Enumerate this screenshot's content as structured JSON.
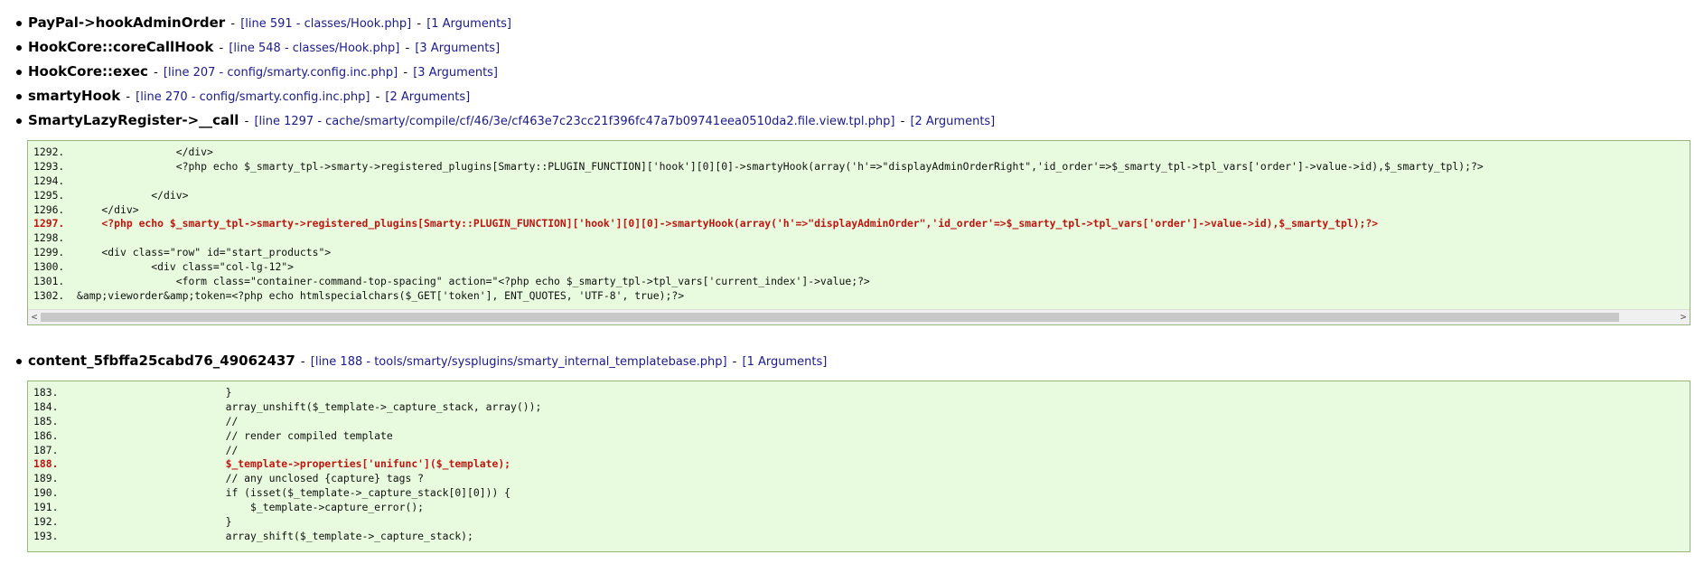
{
  "frames": [
    {
      "fn": "PayPal->hookAdminOrder",
      "location": "[line 591 - classes/Hook.php]",
      "args": "[1 Arguments]"
    },
    {
      "fn": "HookCore::coreCallHook",
      "location": "[line 548 - classes/Hook.php]",
      "args": "[3 Arguments]"
    },
    {
      "fn": "HookCore::exec",
      "location": "[line 207 - config/smarty.config.inc.php]",
      "args": "[3 Arguments]"
    },
    {
      "fn": "smartyHook",
      "location": "[line 270 - config/smarty.config.inc.php]",
      "args": "[2 Arguments]"
    },
    {
      "fn": "SmartyLazyRegister->__call",
      "location": "[line 1297 - cache/smarty/compile/cf/46/3e/cf463e7c23cc21f396fc47a7b09741eea0510da2.file.view.tpl.php]",
      "args": "[2 Arguments]"
    },
    {
      "fn": "content_5fbffa25cabd76_49062437",
      "location": "[line 188 - tools/smarty/sysplugins/smarty_internal_templatebase.php]",
      "args": "[1 Arguments]"
    }
  ],
  "separator": "-",
  "code_block_1": {
    "lines": [
      {
        "num": "1292.",
        "text": "                </div>",
        "highlight": false
      },
      {
        "num": "1293.",
        "text": "                <?php echo $_smarty_tpl->smarty->registered_plugins[Smarty::PLUGIN_FUNCTION]['hook'][0][0]->smartyHook(array('h'=>\"displayAdminOrderRight\",'id_order'=>$_smarty_tpl->tpl_vars['order']->value->id),$_smarty_tpl);?>",
        "highlight": false
      },
      {
        "num": "1294.",
        "text": "",
        "highlight": false
      },
      {
        "num": "1295.",
        "text": "            </div>",
        "highlight": false
      },
      {
        "num": "1296.",
        "text": "    </div>",
        "highlight": false
      },
      {
        "num": "1297.",
        "text": "    <?php echo $_smarty_tpl->smarty->registered_plugins[Smarty::PLUGIN_FUNCTION]['hook'][0][0]->smartyHook(array('h'=>\"displayAdminOrder\",'id_order'=>$_smarty_tpl->tpl_vars['order']->value->id),$_smarty_tpl);?>",
        "highlight": true
      },
      {
        "num": "1298.",
        "text": "",
        "highlight": false
      },
      {
        "num": "1299.",
        "text": "    <div class=\"row\" id=\"start_products\">",
        "highlight": false
      },
      {
        "num": "1300.",
        "text": "            <div class=\"col-lg-12\">",
        "highlight": false
      },
      {
        "num": "1301.",
        "text": "                <form class=\"container-command-top-spacing\" action=\"<?php echo $_smarty_tpl->tpl_vars['current_index']->value;?>",
        "highlight": false
      },
      {
        "num": "1302.",
        "text": "&amp;vieworder&amp;token=<?php echo htmlspecialchars($_GET['token'], ENT_QUOTES, 'UTF-8', true);?>",
        "highlight": false
      }
    ],
    "scroll_left": "<",
    "scroll_right": ">"
  },
  "code_block_2": {
    "lines": [
      {
        "num": "183.",
        "text": "                        }",
        "highlight": false
      },
      {
        "num": "184.",
        "text": "                        array_unshift($_template->_capture_stack, array());",
        "highlight": false
      },
      {
        "num": "185.",
        "text": "                        //",
        "highlight": false
      },
      {
        "num": "186.",
        "text": "                        // render compiled template",
        "highlight": false
      },
      {
        "num": "187.",
        "text": "                        //",
        "highlight": false
      },
      {
        "num": "188.",
        "text": "                        $_template->properties['unifunc']($_template);",
        "highlight": true
      },
      {
        "num": "189.",
        "text": "                        // any unclosed {capture} tags ?",
        "highlight": false
      },
      {
        "num": "190.",
        "text": "                        if (isset($_template->_capture_stack[0][0])) {",
        "highlight": false
      },
      {
        "num": "191.",
        "text": "                            $_template->capture_error();",
        "highlight": false
      },
      {
        "num": "192.",
        "text": "                        }",
        "highlight": false
      },
      {
        "num": "193.",
        "text": "                        array_shift($_template->_capture_stack);",
        "highlight": false
      }
    ]
  }
}
